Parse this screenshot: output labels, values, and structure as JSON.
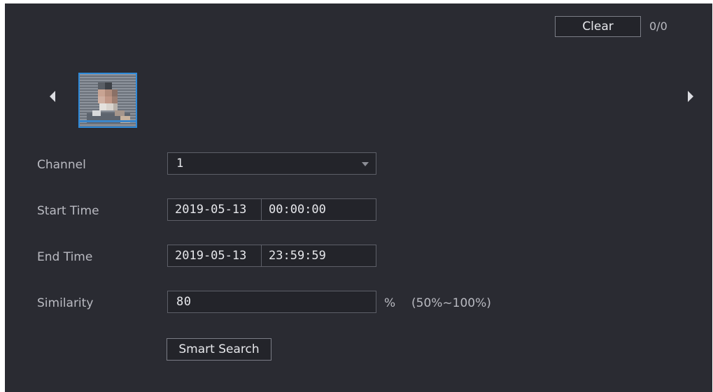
{
  "header": {
    "clear_label": "Clear",
    "counter": "0/0"
  },
  "face_strip": {
    "prev_icon": "triangle-left-icon",
    "next_icon": "triangle-right-icon"
  },
  "form": {
    "channel": {
      "label": "Channel",
      "value": "1"
    },
    "start_time": {
      "label": "Start Time",
      "date": "2019-05-13",
      "time": "00:00:00"
    },
    "end_time": {
      "label": "End Time",
      "date": "2019-05-13",
      "time": "23:59:59"
    },
    "similarity": {
      "label": "Similarity",
      "value": "80",
      "unit": "%",
      "range": "(50%~100%)"
    }
  },
  "actions": {
    "smart_search_label": "Smart Search"
  },
  "colors": {
    "panel_bg": "#2a2b32",
    "accent": "#2f8ad9",
    "text": "#e6e7eb"
  }
}
